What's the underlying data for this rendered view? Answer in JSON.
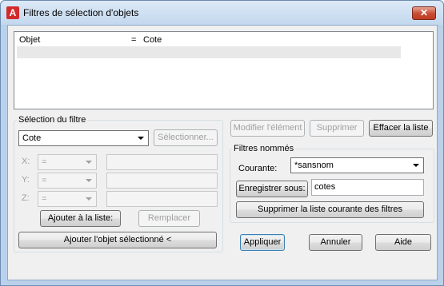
{
  "window": {
    "title": "Filtres de sélection d'objets",
    "close_symbol": "✕",
    "app_icon_letter": "A"
  },
  "list": {
    "rows": [
      {
        "col1": "Objet",
        "col2": "=",
        "col3": "Cote"
      },
      {
        "col1": "",
        "col2": "",
        "col3": ""
      }
    ]
  },
  "filter_selection": {
    "group_label": "Sélection du filtre",
    "filter_value": "Cote",
    "select_button": "Sélectionner...",
    "x_label": "X:",
    "y_label": "Y:",
    "z_label": "Z:",
    "x_op": "=",
    "y_op": "=",
    "z_op": "=",
    "add_to_list_button": "Ajouter à la liste:",
    "replace_button": "Remplacer",
    "add_selected_button": "Ajouter l'objet sélectionné <"
  },
  "list_actions": {
    "edit_button": "Modifier l'élément",
    "delete_button": "Supprimer",
    "clear_button": "Effacer la liste"
  },
  "named_filters": {
    "group_label": "Filtres nommés",
    "current_label": "Courante:",
    "current_value": "*sansnom",
    "save_as_button": "Enregistrer sous:",
    "save_as_value": "cotes",
    "delete_current_button": "Supprimer la liste courante des filtres"
  },
  "footer": {
    "apply_button": "Appliquer",
    "cancel_button": "Annuler",
    "help_button": "Aide"
  }
}
